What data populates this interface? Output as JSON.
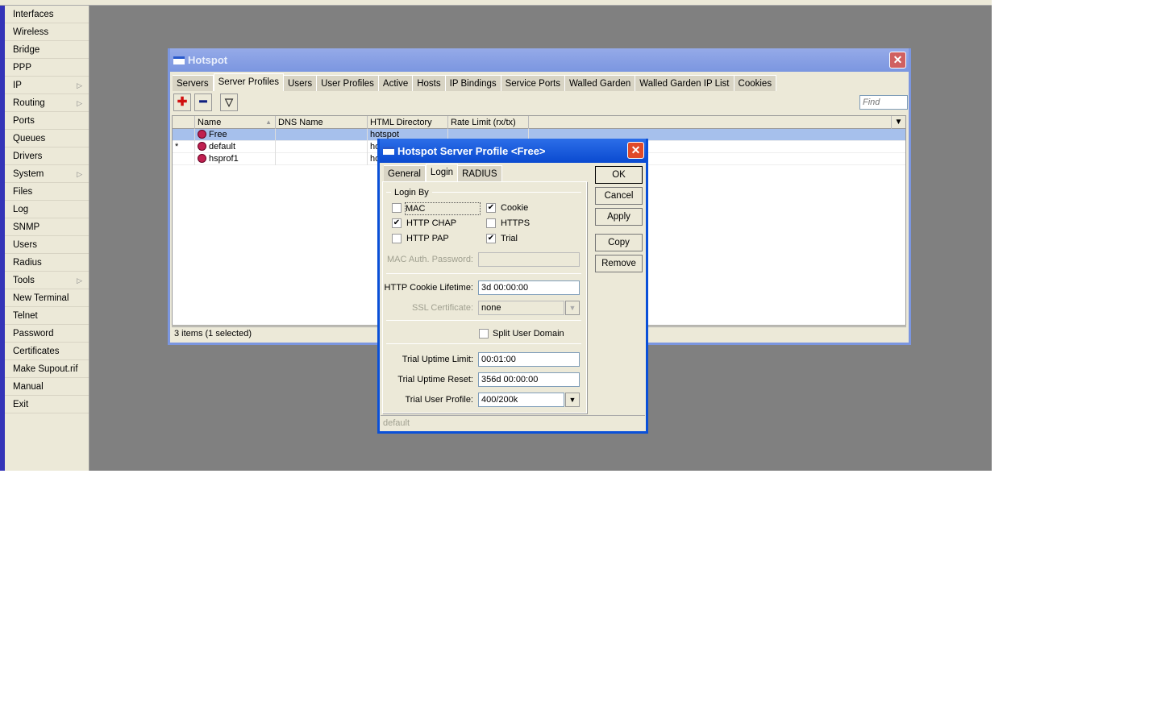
{
  "sidebar": {
    "items": [
      {
        "label": "Interfaces",
        "sub": false
      },
      {
        "label": "Wireless",
        "sub": false
      },
      {
        "label": "Bridge",
        "sub": false
      },
      {
        "label": "PPP",
        "sub": false
      },
      {
        "label": "IP",
        "sub": true
      },
      {
        "label": "Routing",
        "sub": true
      },
      {
        "label": "Ports",
        "sub": false
      },
      {
        "label": "Queues",
        "sub": false
      },
      {
        "label": "Drivers",
        "sub": false
      },
      {
        "label": "System",
        "sub": true
      },
      {
        "label": "Files",
        "sub": false
      },
      {
        "label": "Log",
        "sub": false
      },
      {
        "label": "SNMP",
        "sub": false
      },
      {
        "label": "Users",
        "sub": false
      },
      {
        "label": "Radius",
        "sub": false
      },
      {
        "label": "Tools",
        "sub": true
      },
      {
        "label": "New Terminal",
        "sub": false
      },
      {
        "label": "Telnet",
        "sub": false
      },
      {
        "label": "Password",
        "sub": false
      },
      {
        "label": "Certificates",
        "sub": false
      },
      {
        "label": "Make Supout.rif",
        "sub": false
      },
      {
        "label": "Manual",
        "sub": false
      },
      {
        "label": "Exit",
        "sub": false
      }
    ]
  },
  "hotspot": {
    "title": "Hotspot",
    "tabs": [
      "Servers",
      "Server Profiles",
      "Users",
      "User Profiles",
      "Active",
      "Hosts",
      "IP Bindings",
      "Service Ports",
      "Walled Garden",
      "Walled Garden IP List",
      "Cookies"
    ],
    "active_tab": "Server Profiles",
    "find_placeholder": "Find",
    "columns": [
      "Name",
      "DNS Name",
      "HTML Directory",
      "Rate Limit (rx/tx)"
    ],
    "rows": [
      {
        "flag": "",
        "name": "Free",
        "dns": "",
        "dir": "hotspot",
        "rate": "",
        "selected": true
      },
      {
        "flag": "*",
        "name": "default",
        "dns": "",
        "dir": "ho",
        "rate": "",
        "selected": false
      },
      {
        "flag": "",
        "name": "hsprof1",
        "dns": "",
        "dir": "ho",
        "rate": "",
        "selected": false
      }
    ],
    "status": "3 items (1 selected)"
  },
  "dialog": {
    "title": "Hotspot Server Profile <Free>",
    "tabs": [
      "General",
      "Login",
      "RADIUS"
    ],
    "active_tab": "Login",
    "login_by_label": "Login By",
    "checkboxes": [
      {
        "label": "MAC",
        "checked": false
      },
      {
        "label": "Cookie",
        "checked": true
      },
      {
        "label": "HTTP CHAP",
        "checked": true
      },
      {
        "label": "HTTPS",
        "checked": false
      },
      {
        "label": "HTTP PAP",
        "checked": false
      },
      {
        "label": "Trial",
        "checked": true
      }
    ],
    "mac_auth_password_label": "MAC Auth. Password:",
    "mac_auth_password": "",
    "cookie_lifetime_label": "HTTP Cookie Lifetime:",
    "cookie_lifetime": "3d 00:00:00",
    "ssl_label": "SSL Certificate:",
    "ssl": "none",
    "split_label": "Split User Domain",
    "split_checked": false,
    "trial_limit_label": "Trial Uptime Limit:",
    "trial_limit": "00:01:00",
    "trial_reset_label": "Trial Uptime Reset:",
    "trial_reset": "356d 00:00:00",
    "trial_profile_label": "Trial User Profile:",
    "trial_profile": "400/200k",
    "buttons": {
      "ok": "OK",
      "cancel": "Cancel",
      "apply": "Apply",
      "copy": "Copy",
      "remove": "Remove"
    },
    "status": "default"
  }
}
